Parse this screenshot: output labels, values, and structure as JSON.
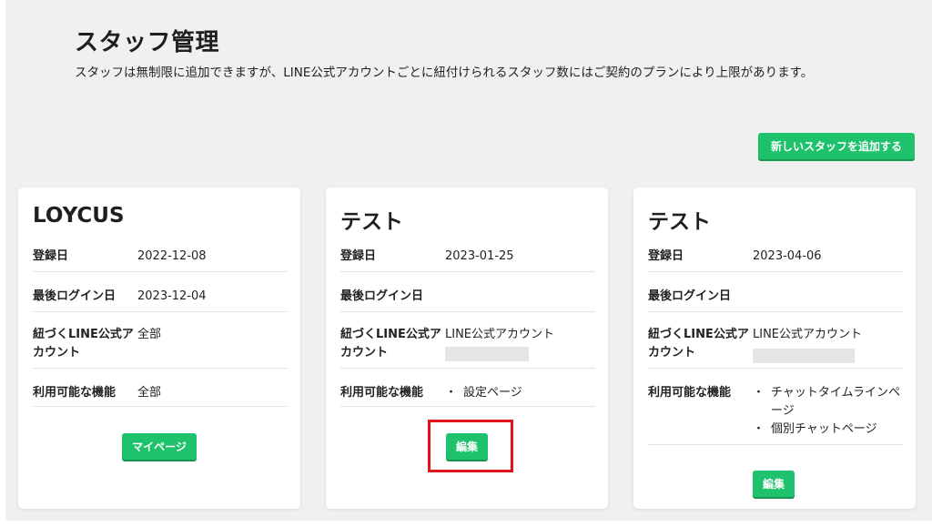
{
  "page": {
    "title": "スタッフ管理",
    "description": "スタッフは無制限に追加できますが、LINE公式アカウントごとに紐付けられるスタッフ数にはご契約のプランにより上限があります。",
    "add_button": "新しいスタッフを追加する"
  },
  "labels": {
    "registered": "登録日",
    "last_login": "最後ログイン日",
    "linked_accounts": "紐づくLINE公式アカウント",
    "features": "利用可能な機能"
  },
  "cards": [
    {
      "name": "LOYCUS",
      "registered": "2022-12-08",
      "last_login": "2023-12-04",
      "linked_accounts": "全部",
      "features": "全部",
      "button": "マイページ"
    },
    {
      "name": "テスト",
      "registered": "2023-01-25",
      "last_login": "",
      "linked_accounts": "LINE公式アカウント",
      "features": [
        "設定ページ"
      ],
      "button": "編集"
    },
    {
      "name": "テスト",
      "registered": "2023-04-06",
      "last_login": "",
      "linked_accounts": "LINE公式アカウント",
      "features": [
        "チャットタイムラインページ",
        "個別チャットページ"
      ],
      "button": "編集"
    }
  ],
  "colors": {
    "accent": "#1fc26c",
    "highlight": "#e0141c",
    "background": "#eff0f0"
  }
}
